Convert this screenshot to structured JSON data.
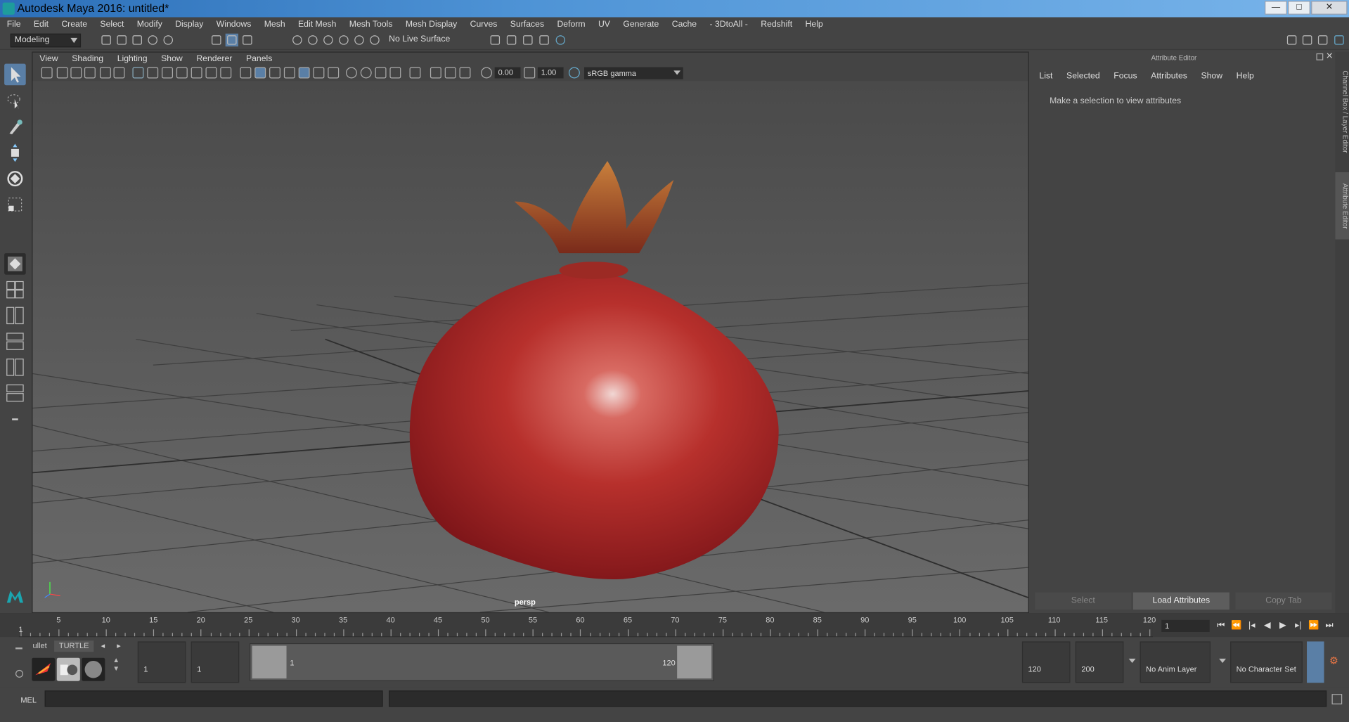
{
  "window": {
    "title": "Autodesk Maya 2016: untitled*",
    "buttons": {
      "minimize": "—",
      "maximize": "□",
      "close": "✕"
    }
  },
  "menubar": [
    "File",
    "Edit",
    "Create",
    "Select",
    "Modify",
    "Display",
    "Windows",
    "Mesh",
    "Edit Mesh",
    "Mesh Tools",
    "Mesh Display",
    "Curves",
    "Surfaces",
    "Deform",
    "UV",
    "Generate",
    "Cache",
    "- 3DtoAll -",
    "Redshift",
    "Help"
  ],
  "toolbar": {
    "mode": "Modeling",
    "live_surface": "No Live Surface"
  },
  "viewport": {
    "menu": [
      "View",
      "Shading",
      "Lighting",
      "Show",
      "Renderer",
      "Panels"
    ],
    "exposure": "0.00",
    "gamma_value": "1.00",
    "color_space": "sRGB gamma",
    "camera": "persp"
  },
  "attribute_editor": {
    "title": "Attribute Editor",
    "menu": [
      "List",
      "Selected",
      "Focus",
      "Attributes",
      "Show",
      "Help"
    ],
    "message": "Make a selection to view attributes",
    "buttons": {
      "select": "Select",
      "load": "Load Attributes",
      "copy": "Copy Tab"
    }
  },
  "side_tabs": {
    "channel_box": "Channel Box / Layer Editor",
    "attribute_editor": "Attribute Editor"
  },
  "timeline": {
    "ticks": [
      "1",
      "5",
      "10",
      "15",
      "20",
      "25",
      "30",
      "35",
      "40",
      "45",
      "50",
      "55",
      "60",
      "65",
      "70",
      "75",
      "80",
      "85",
      "90",
      "95",
      "100",
      "105",
      "110",
      "115",
      "120"
    ],
    "current_frame": "1"
  },
  "range": {
    "shelf_tabs": [
      "ullet",
      "TURTLE"
    ],
    "start_anim": "1",
    "start_play": "1",
    "range_start": "1",
    "range_end": "120",
    "end_play": "120",
    "end_anim": "200",
    "anim_layer": "No Anim Layer",
    "character_set": "No Character Set"
  },
  "command": {
    "label": "MEL"
  },
  "colors": {
    "accent": "#5a7fa6",
    "title_gradient_start": "#2c6fb8",
    "fruit": "#b2272a"
  }
}
